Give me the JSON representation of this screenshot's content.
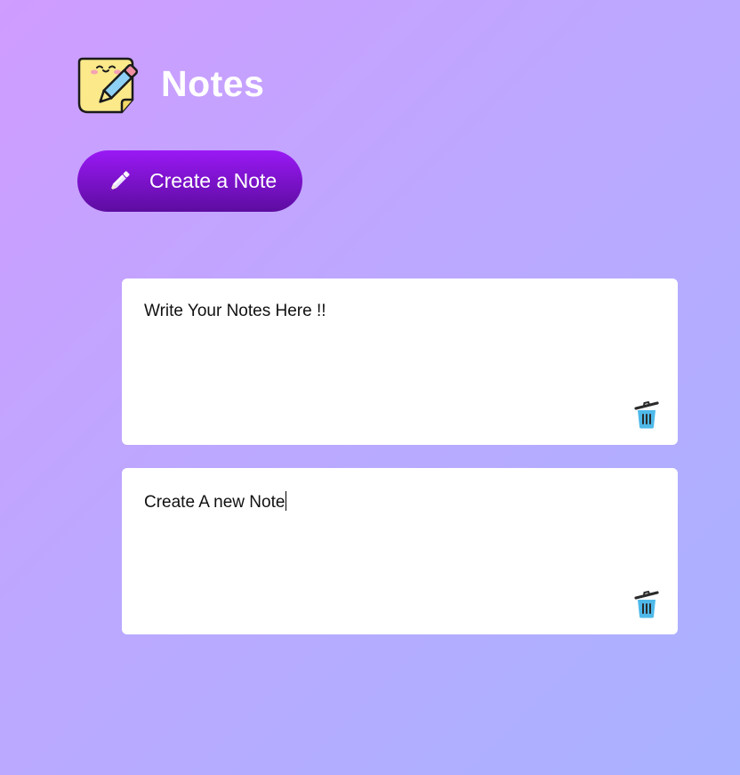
{
  "app": {
    "title": "Notes",
    "logo_icon": "sticky-note-pencil-icon"
  },
  "toolbar": {
    "create_label": "Create a Note",
    "create_icon": "pencil-icon"
  },
  "notes": [
    {
      "text": "Write Your Notes Here !!",
      "delete_icon": "trash-icon"
    },
    {
      "text": "Create A new Note",
      "delete_icon": "trash-icon",
      "focused": true
    }
  ],
  "colors": {
    "accent": "#8a14e0",
    "background_start": "#cf9cff",
    "background_end": "#a9b2ff",
    "card": "#ffffff",
    "trash": "#4fb9ea"
  }
}
